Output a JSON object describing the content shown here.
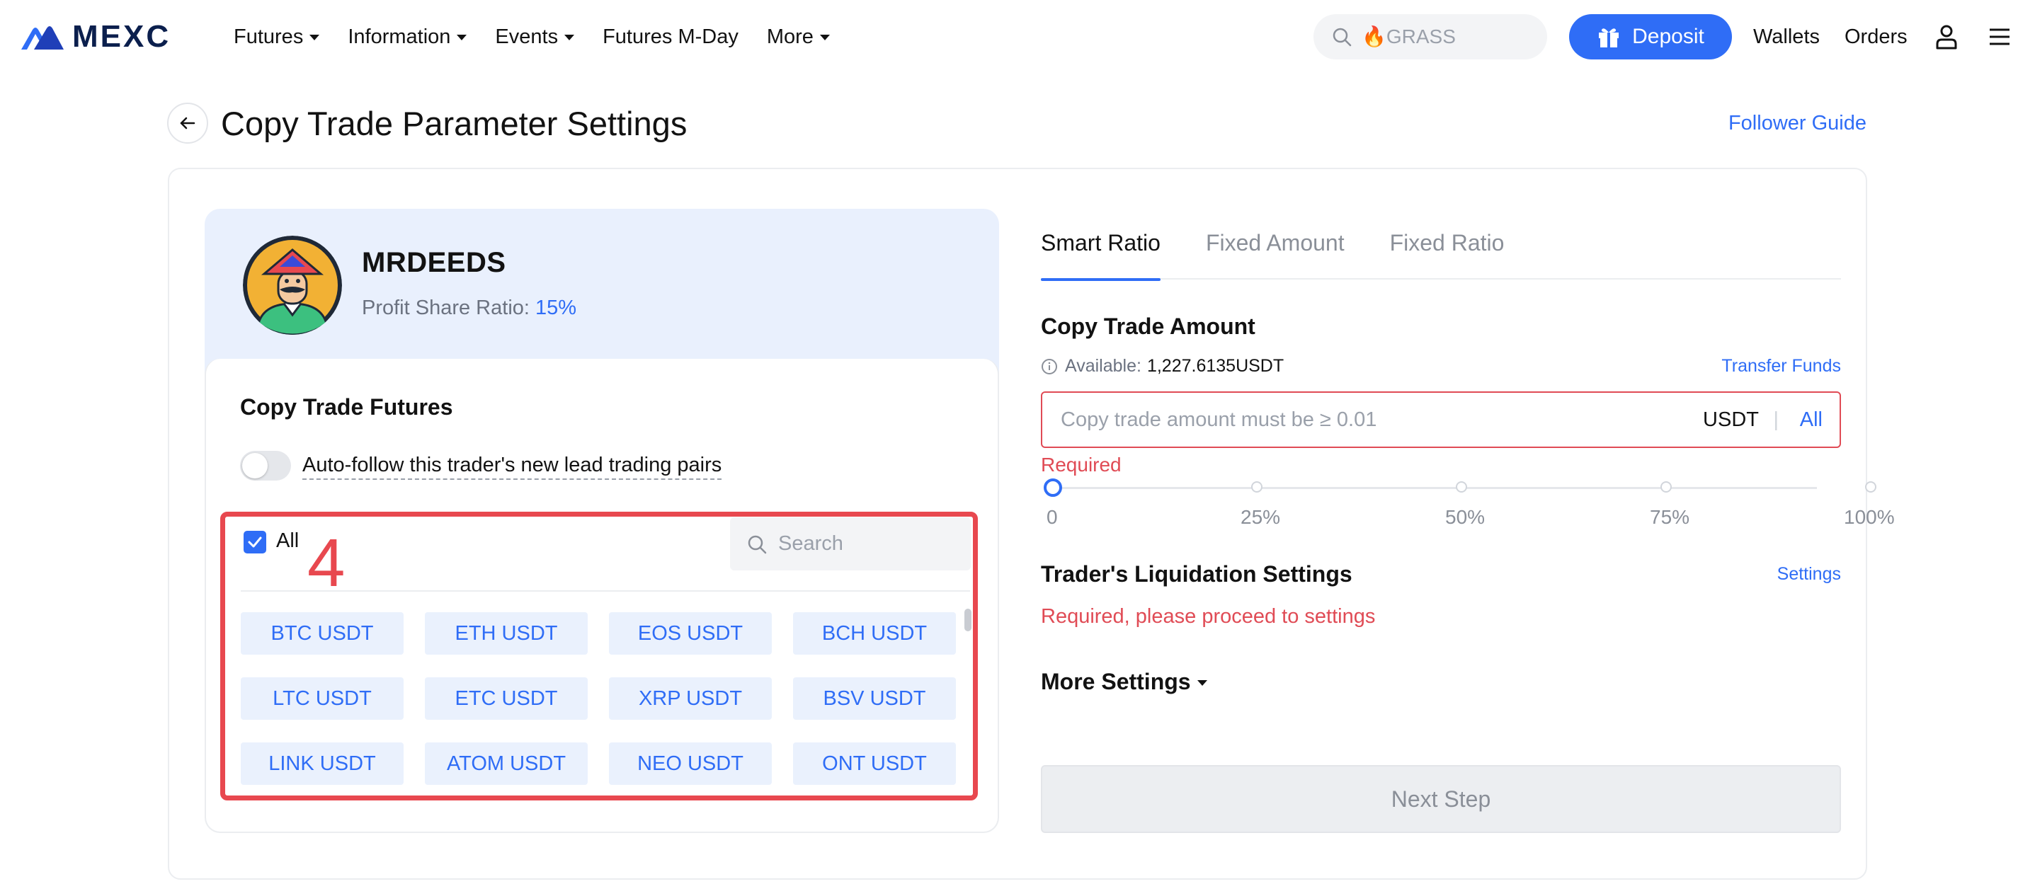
{
  "header": {
    "logo_text": "MEXC",
    "nav": [
      {
        "label": "Futures",
        "has_caret": true
      },
      {
        "label": "Information",
        "has_caret": true
      },
      {
        "label": "Events",
        "has_caret": true
      },
      {
        "label": "Futures M-Day",
        "has_caret": false
      },
      {
        "label": "More",
        "has_caret": true
      }
    ],
    "search_placeholder": "🔥GRASS",
    "deposit_label": "Deposit",
    "wallets_label": "Wallets",
    "orders_label": "Orders",
    "icons": {
      "search": "search-icon",
      "gift": "gift-icon",
      "user": "user-icon",
      "menu": "menu-icon"
    }
  },
  "page": {
    "title": "Copy Trade Parameter Settings",
    "follower_guide": "Follower Guide"
  },
  "trader": {
    "name": "MRDEEDS",
    "profit_share_label": "Profit Share Ratio:",
    "profit_share_value": "15%"
  },
  "futures": {
    "title": "Copy Trade Futures",
    "auto_follow_label": "Auto-follow this trader's new lead trading pairs",
    "auto_follow_on": false,
    "all_label": "All",
    "all_checked": true,
    "annotation_number": "4",
    "search_placeholder": "Search",
    "pairs": [
      "BTC USDT",
      "ETH USDT",
      "EOS USDT",
      "BCH USDT",
      "LTC USDT",
      "ETC USDT",
      "XRP USDT",
      "BSV USDT",
      "LINK USDT",
      "ATOM USDT",
      "NEO USDT",
      "ONT USDT"
    ]
  },
  "settings": {
    "tabs": [
      {
        "label": "Smart Ratio",
        "active": true
      },
      {
        "label": "Fixed Amount",
        "active": false
      },
      {
        "label": "Fixed Ratio",
        "active": false
      }
    ],
    "amount_title": "Copy Trade Amount",
    "available_label": "Available:",
    "available_value": "1,227.6135USDT",
    "transfer_label": "Transfer Funds",
    "amount_placeholder": "Copy trade amount must be ≥ 0.01",
    "unit": "USDT",
    "separator": "|",
    "all_label": "All",
    "required_label": "Required",
    "slider_labels": [
      "0",
      "25%",
      "50%",
      "75%",
      "100%"
    ],
    "slider_value": 0,
    "liq_title": "Trader's Liquidation Settings",
    "liq_settings_link": "Settings",
    "liq_required": "Required, please proceed to settings",
    "more_settings": "More Settings",
    "next_step": "Next Step"
  },
  "colors": {
    "accent": "#2f6df6",
    "error": "#e04b55",
    "annotation": "#e8484f",
    "panel_bg": "#e9f0fd",
    "chip_bg": "#eaf1fd"
  }
}
